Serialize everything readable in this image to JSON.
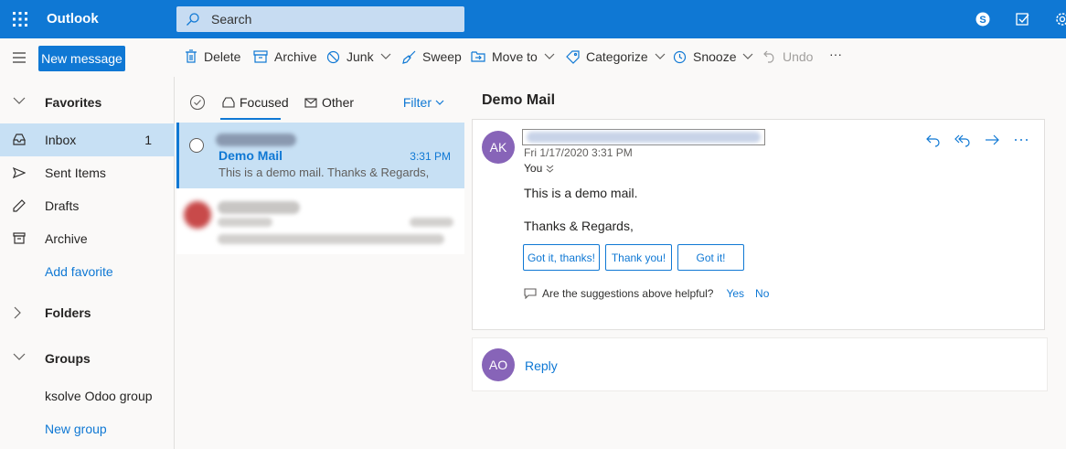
{
  "header": {
    "app_name": "Outlook",
    "search_placeholder": "Search",
    "icons": [
      "waffle-icon",
      "skype-icon",
      "todo-icon",
      "settings-icon"
    ],
    "accent_color": "#0f78d4"
  },
  "toolbar": {
    "new_message": "New message",
    "commands": [
      {
        "label": "Delete",
        "icon": "trash-icon"
      },
      {
        "label": "Archive",
        "icon": "archive-icon"
      },
      {
        "label": "Junk",
        "icon": "block-icon",
        "dropdown": true
      },
      {
        "label": "Sweep",
        "icon": "broom-icon"
      },
      {
        "label": "Move to",
        "icon": "folder-move-icon",
        "dropdown": true
      },
      {
        "label": "Categorize",
        "icon": "tag-icon",
        "dropdown": true
      },
      {
        "label": "Snooze",
        "icon": "clock-icon",
        "dropdown": true
      },
      {
        "label": "Undo",
        "icon": "undo-icon",
        "disabled": true
      }
    ],
    "more": "···"
  },
  "nav": {
    "favorites_label": "Favorites",
    "items": [
      {
        "label": "Inbox",
        "count": "1",
        "icon": "inbox-icon"
      },
      {
        "label": "Sent Items",
        "icon": "send-icon"
      },
      {
        "label": "Drafts",
        "icon": "pencil-icon"
      },
      {
        "label": "Archive",
        "icon": "archive-icon"
      }
    ],
    "add_favorite": "Add favorite",
    "folders_label": "Folders",
    "groups_label": "Groups",
    "group_name": "ksolve Odoo group",
    "new_group": "New group"
  },
  "message_list": {
    "tab_focused": "Focused",
    "tab_other": "Other",
    "filter": "Filter",
    "selected_message": {
      "subject": "Demo Mail",
      "time": "3:31 PM",
      "preview": "This is a demo mail. Thanks & Regards,"
    }
  },
  "reading_pane": {
    "title": "Demo Mail",
    "sender_initials": "AK",
    "date": "Fri 1/17/2020 3:31 PM",
    "to": "You",
    "body_line1": "This is a demo mail.",
    "body_line2": "Thanks & Regards,",
    "suggestions": [
      "Got it, thanks!",
      "Thank you!",
      "Got it!"
    ],
    "helpful_question": "Are the suggestions above helpful?",
    "yes": "Yes",
    "no": "No",
    "reply_initials": "AO",
    "reply_label": "Reply"
  }
}
